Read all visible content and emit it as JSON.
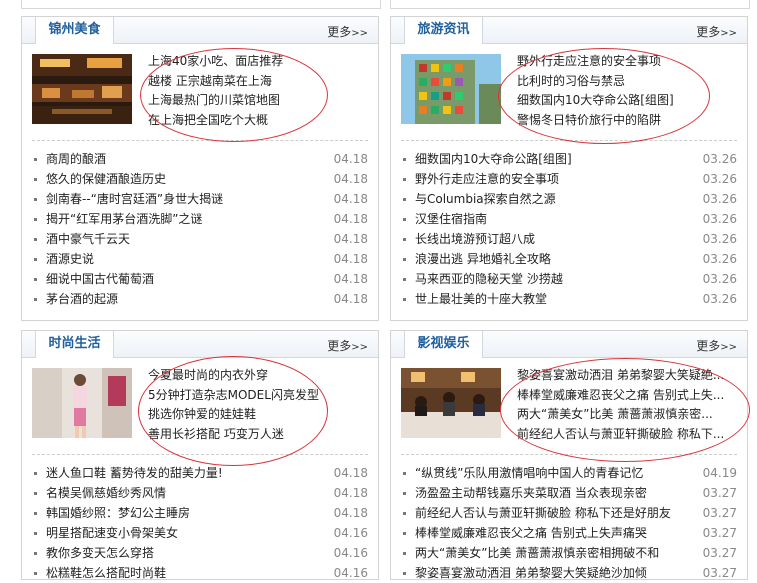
{
  "panels": {
    "food": {
      "title": "锦州美食",
      "more": "更多",
      "more_arrow": ">>",
      "featured": [
        "上海40家小吃、面店推荐",
        "越楼 正宗越南菜在上海",
        "上海最热门的川菜馆地图",
        "在上海把全国吃个大概"
      ],
      "news": [
        {
          "title": "商周的酿酒",
          "date": "04.18"
        },
        {
          "title": "悠久的保健酒酿造历史",
          "date": "04.18"
        },
        {
          "title": "剑南春--“唐时宫廷酒”身世大揭谜",
          "date": "04.18"
        },
        {
          "title": "揭开“红军用茅台酒洗脚”之谜",
          "date": "04.18"
        },
        {
          "title": "酒中豪气千云天",
          "date": "04.18"
        },
        {
          "title": "酒源史说",
          "date": "04.18"
        },
        {
          "title": "细说中国古代葡萄酒",
          "date": "04.18"
        },
        {
          "title": "茅台酒的起源",
          "date": "04.18"
        }
      ]
    },
    "travel": {
      "title": "旅游资讯",
      "more": "更多",
      "more_arrow": ">>",
      "featured": [
        "野外行走应注意的安全事项",
        "比利时的习俗与禁忌",
        "细数国内10大夺命公路[组图]",
        "警惕冬日特价旅行中的陷阱"
      ],
      "news": [
        {
          "title": "细数国内10大夺命公路[组图]",
          "date": "03.26"
        },
        {
          "title": "野外行走应注意的安全事项",
          "date": "03.26"
        },
        {
          "title": "与Columbia探索自然之源",
          "date": "03.26"
        },
        {
          "title": "汉堡住宿指南",
          "date": "03.26"
        },
        {
          "title": "长线出境游预订超八成",
          "date": "03.26"
        },
        {
          "title": "浪漫出逃 异地婚礼全攻略",
          "date": "03.26"
        },
        {
          "title": "马来西亚的隐秘天堂 沙捞越",
          "date": "03.26"
        },
        {
          "title": "世上最壮美的十座大教堂",
          "date": "03.26"
        }
      ]
    },
    "fashion": {
      "title": "时尚生活",
      "more": "更多",
      "more_arrow": ">>",
      "featured": [
        "今夏最时尚的内衣外穿",
        "5分钟打造杂志MODEL闪亮发型",
        "挑选你钟爱的娃娃鞋",
        "善用长衫搭配 巧变万人迷"
      ],
      "news": [
        {
          "title": "迷人鱼口鞋 蓄势待发的甜美力量!",
          "date": "04.18"
        },
        {
          "title": "名模吴佩慈婚纱秀风情",
          "date": "04.18"
        },
        {
          "title": "韩国婚纱照：梦幻公主睡房",
          "date": "04.18"
        },
        {
          "title": "明星搭配速变小骨架美女",
          "date": "04.16"
        },
        {
          "title": "教你多变天怎么穿搭",
          "date": "04.16"
        },
        {
          "title": "松糕鞋怎么搭配时尚鞋",
          "date": "04.16"
        }
      ]
    },
    "ent": {
      "title": "影视娱乐",
      "more": "更多",
      "more_arrow": ">>",
      "featured": [
        "黎姿喜宴激动洒泪 弟弟黎婴大笑疑絶...",
        "棒棒堂威廉难忍丧父之痛 告别式上失...",
        "两大“萧美女”比美 萧蔷萧淑慎亲密...",
        "前经纪人否认与萧亚轩撕破脸 称私下..."
      ],
      "news": [
        {
          "title": "“纵贯线”乐队用激情唱响中国人的青春记忆",
          "date": "04.19"
        },
        {
          "title": "汤盈盈主动帮钱嘉乐夹菜取酒 当众表现亲密",
          "date": "03.27"
        },
        {
          "title": "前经纪人否认与萧亚轩撕破脸 称私下还是好朋友",
          "date": "03.27"
        },
        {
          "title": "棒棒堂威廉难忍丧父之痛 告别式上失声痛哭",
          "date": "03.27"
        },
        {
          "title": "两大“萧美女”比美 萧蔷萧淑慎亲密相拥破不和",
          "date": "03.27"
        },
        {
          "title": "黎姿喜宴激动洒泪 弟弟黎婴大笑疑絶沙加倾",
          "date": "03.27"
        }
      ]
    }
  },
  "colors": {
    "tab_text": "#1f5f9e",
    "annotation": "#d9343b"
  }
}
